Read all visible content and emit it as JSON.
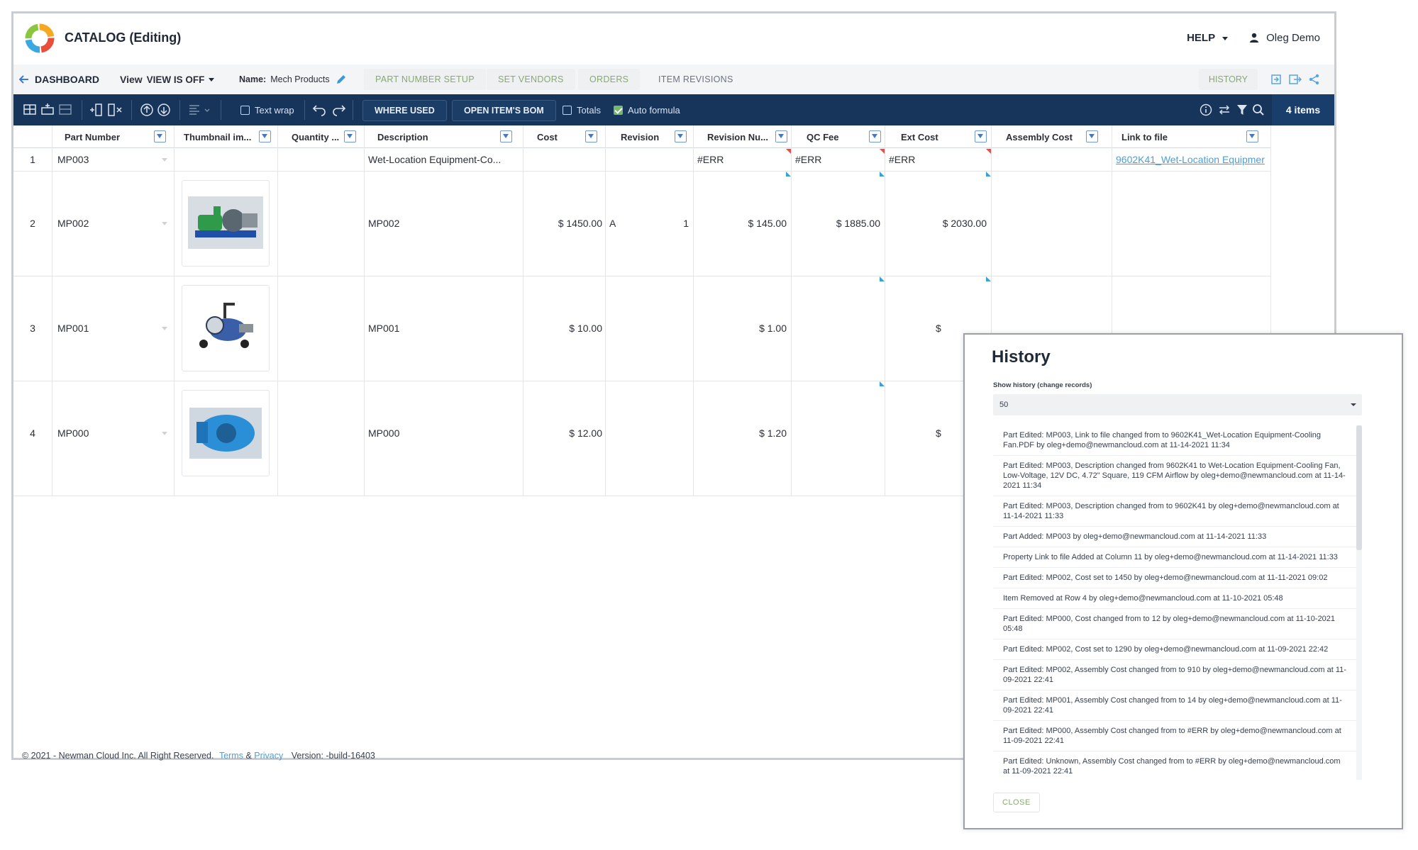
{
  "app": {
    "title": "CATALOG (Editing)",
    "help_label": "HELP",
    "user_name": "Oleg Demo"
  },
  "nav": {
    "dashboard_label": "DASHBOARD",
    "view_label": "View",
    "view_value": "VIEW IS OFF",
    "name_label": "Name:",
    "name_value": "Mech Products",
    "tabs": [
      "PART NUMBER SETUP",
      "SET VENDORS",
      "ORDERS",
      "ITEM REVISIONS"
    ],
    "history_label": "HISTORY"
  },
  "toolbar": {
    "text_wrap_label": "Text wrap",
    "where_used_label": "WHERE USED",
    "open_bom_label": "OPEN ITEM'S BOM",
    "totals_label": "Totals",
    "auto_formula_label": "Auto formula",
    "items_count": "4 items"
  },
  "grid": {
    "columns": [
      "Part Number",
      "Thumbnail im...",
      "Quantity ...",
      "Description",
      "Cost",
      "Revision",
      "Revision Nu...",
      "QC Fee",
      "Ext Cost",
      "Assembly Cost",
      "Link to file"
    ],
    "rows": [
      {
        "num": "1",
        "part": "MP003",
        "desc": "Wet-Location Equipment-Co...",
        "cost": "",
        "rev": "",
        "revnum": "",
        "qc": "#ERR",
        "ext": "#ERR",
        "asm": "#ERR",
        "link": "9602K41_Wet-Location Equipmer"
      },
      {
        "num": "2",
        "part": "MP002",
        "desc": "MP002",
        "cost": "$ 1450.00",
        "rev": "A",
        "revnum": "1",
        "qc": "$ 145.00",
        "ext": "$ 1885.00",
        "asm": "$ 2030.00",
        "link": ""
      },
      {
        "num": "3",
        "part": "MP001",
        "desc": "MP001",
        "cost": "$ 10.00",
        "rev": "",
        "revnum": "",
        "qc": "$ 1.00",
        "ext": "$",
        "asm": "",
        "link": ""
      },
      {
        "num": "4",
        "part": "MP000",
        "desc": "MP000",
        "cost": "$ 12.00",
        "rev": "",
        "revnum": "",
        "qc": "$ 1.20",
        "ext": "$",
        "asm": "",
        "link": ""
      }
    ]
  },
  "footer": {
    "copyright": "© 2021 - Newman Cloud Inc. All Right Reserved.",
    "terms": "Terms",
    "amp": "&",
    "privacy": "Privacy",
    "version": "Version: -build-16403"
  },
  "history": {
    "title": "History",
    "show_label": "Show history (change records)",
    "select_value": "50",
    "close_label": "CLOSE",
    "records": [
      "Part Edited: MP003, Link to file changed from to 9602K41_Wet-Location Equipment-Cooling Fan.PDF by oleg+demo@newmancloud.com at 11-14-2021 11:34",
      "Part Edited: MP003, Description changed from 9602K41 to Wet-Location Equipment-Cooling Fan, Low-Voltage, 12V DC, 4.72\" Square, 119 CFM Airflow by oleg+demo@newmancloud.com at 11-14-2021 11:34",
      "Part Edited: MP003, Description changed from to 9602K41 by oleg+demo@newmancloud.com at 11-14-2021 11:33",
      "Part Added: MP003 by oleg+demo@newmancloud.com at 11-14-2021 11:33",
      "Property Link to file Added at Column 11 by oleg+demo@newmancloud.com at 11-14-2021 11:33",
      "Part Edited: MP002, Cost set to 1450 by oleg+demo@newmancloud.com at 11-11-2021 09:02",
      "Item Removed at Row 4 by oleg+demo@newmancloud.com at 11-10-2021 05:48",
      "Part Edited: MP000, Cost changed from to 12 by oleg+demo@newmancloud.com at 11-10-2021 05:48",
      "Part Edited: MP002, Cost set to 1290 by oleg+demo@newmancloud.com at 11-09-2021 22:42",
      "Part Edited: MP002, Assembly Cost changed from to 910 by oleg+demo@newmancloud.com at 11-09-2021 22:41",
      "Part Edited: MP001, Assembly Cost changed from to 14 by oleg+demo@newmancloud.com at 11-09-2021 22:41",
      "Part Edited: MP000, Assembly Cost changed from to #ERR by oleg+demo@newmancloud.com at 11-09-2021 22:41",
      "Part Edited: Unknown, Assembly Cost changed from to #ERR by oleg+demo@newmancloud.com at 11-09-2021 22:41"
    ]
  }
}
